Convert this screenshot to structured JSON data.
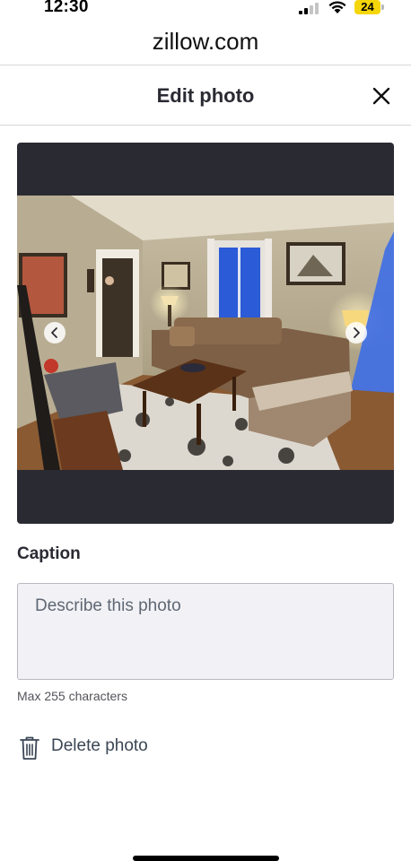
{
  "status_bar": {
    "time": "12:30",
    "battery_level": "24",
    "icons": [
      "signal-icon",
      "wifi-icon",
      "battery-icon"
    ]
  },
  "browser": {
    "url": "zillow.com"
  },
  "header": {
    "title": "Edit photo",
    "close_icon": "close-icon"
  },
  "photo_viewer": {
    "prev_icon": "chevron-left-icon",
    "next_icon": "chevron-right-icon"
  },
  "caption": {
    "label": "Caption",
    "placeholder": "Describe this photo",
    "value": "",
    "helper": "Max 255 characters"
  },
  "delete": {
    "label": "Delete photo",
    "icon": "trash-icon"
  },
  "colors": {
    "text_primary": "#2a2a33",
    "viewer_background": "#2a2a33",
    "input_background": "#f2f2f6",
    "battery": "#f5d60a",
    "delete_text": "#3b4654"
  }
}
